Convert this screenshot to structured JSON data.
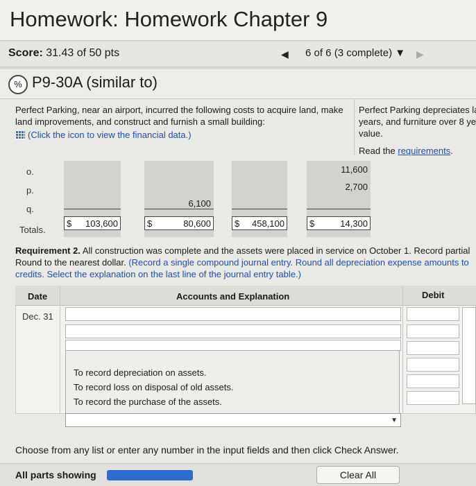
{
  "header": {
    "title": "Homework: Homework Chapter 9"
  },
  "score": {
    "label": "Score:",
    "value": "31.43 of 50 pts"
  },
  "nav": {
    "progress": "6 of 6 (3 complete) ▼"
  },
  "question": {
    "badge": "%",
    "id": "P9-30A (similar to)"
  },
  "problem": {
    "text": "Perfect Parking, near an airport, incurred the following costs to acquire land, make land improvements, and construct and furnish a small building:",
    "data_link": "(Click the icon to view the financial data.)",
    "right_text_1": "Perfect Parking depreciates la",
    "right_text_2": "years, and furniture over 8 ye",
    "right_text_3": "value.",
    "read_prefix": "Read the ",
    "read_link": "requirements",
    "read_suffix": "."
  },
  "cost_table": {
    "rows": [
      {
        "label": "o.",
        "col4": "11,600"
      },
      {
        "label": "p.",
        "col4": "2,700"
      },
      {
        "label": "q.",
        "col2": "6,100"
      }
    ],
    "totals_label": "Totals.",
    "totals": [
      {
        "currency": "$",
        "value": "103,600"
      },
      {
        "currency": "$",
        "value": "80,600"
      },
      {
        "currency": "$",
        "value": "458,100"
      },
      {
        "currency": "$",
        "value": "14,300"
      }
    ]
  },
  "requirement": {
    "bold": "Requirement 2.",
    "text1": " All construction was complete and the assets were placed in service on October 1. Record partial",
    "text2": "Round to the nearest dollar. ",
    "blue": "(Record a single compound journal entry. Round all depreciation expense amounts to",
    "blue2": "credits. Select the explanation on the last line of the journal entry table.)"
  },
  "journal": {
    "col_date": "Date",
    "col_accounts": "Accounts and Explanation",
    "col_debit": "Debit",
    "date_value": "Dec. 31",
    "options": [
      "To record depreciation on assets.",
      "To record loss on disposal of old assets.",
      "To record the purchase of the assets."
    ]
  },
  "footer": {
    "message": "Choose from any list or enter any number in the input fields and then click Check Answer.",
    "all_parts": "All parts showing",
    "clear_all": "Clear All"
  }
}
